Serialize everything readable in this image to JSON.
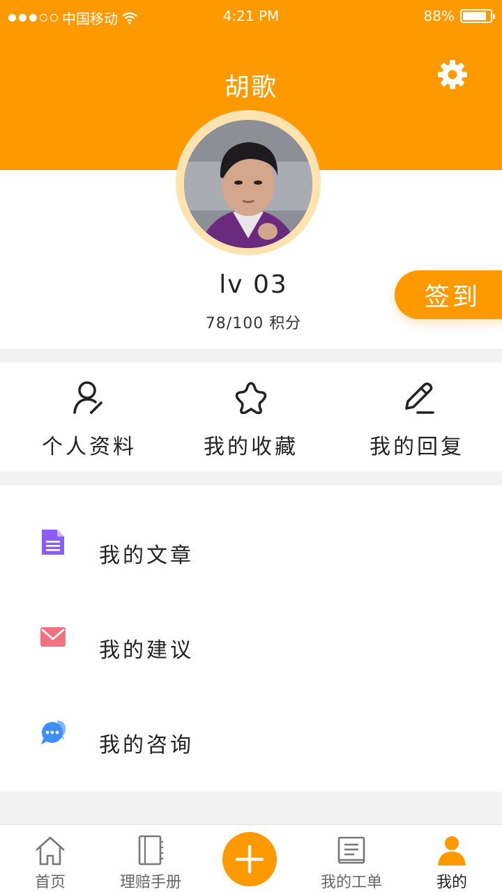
{
  "status_bar": {
    "carrier": "中国移动",
    "time": "4:21 PM",
    "battery": "88%",
    "battery_level": 0.88,
    "signal_dots_filled": 3,
    "signal_dots_total": 5
  },
  "header": {
    "title": "胡歌",
    "settings_icon": "gear-icon",
    "background_color": "#ff9900"
  },
  "profile": {
    "level": "lv 03",
    "points": "78/100 积分",
    "checkin_label": "签到"
  },
  "quick_actions": [
    {
      "label": "个人资料",
      "icon": "user-edit-icon"
    },
    {
      "label": "我的收藏",
      "icon": "star-icon"
    },
    {
      "label": "我的回复",
      "icon": "pencil-icon"
    }
  ],
  "menu": [
    {
      "label": "我的文章",
      "icon": "document-icon",
      "color": "#8b5cf6"
    },
    {
      "label": "我的建议",
      "icon": "mail-icon",
      "color": "#f47180"
    },
    {
      "label": "我的咨询",
      "icon": "chat-icon",
      "color": "#3b8ff5"
    }
  ],
  "tabbar": {
    "items": [
      {
        "label": "首页",
        "icon": "home-icon"
      },
      {
        "label": "理赔手册",
        "icon": "notebook-icon"
      },
      {
        "label": "",
        "icon": "plus-icon"
      },
      {
        "label": "我的工单",
        "icon": "list-document-icon"
      },
      {
        "label": "我的",
        "icon": "person-icon"
      }
    ],
    "active_color": "#ff9900"
  }
}
